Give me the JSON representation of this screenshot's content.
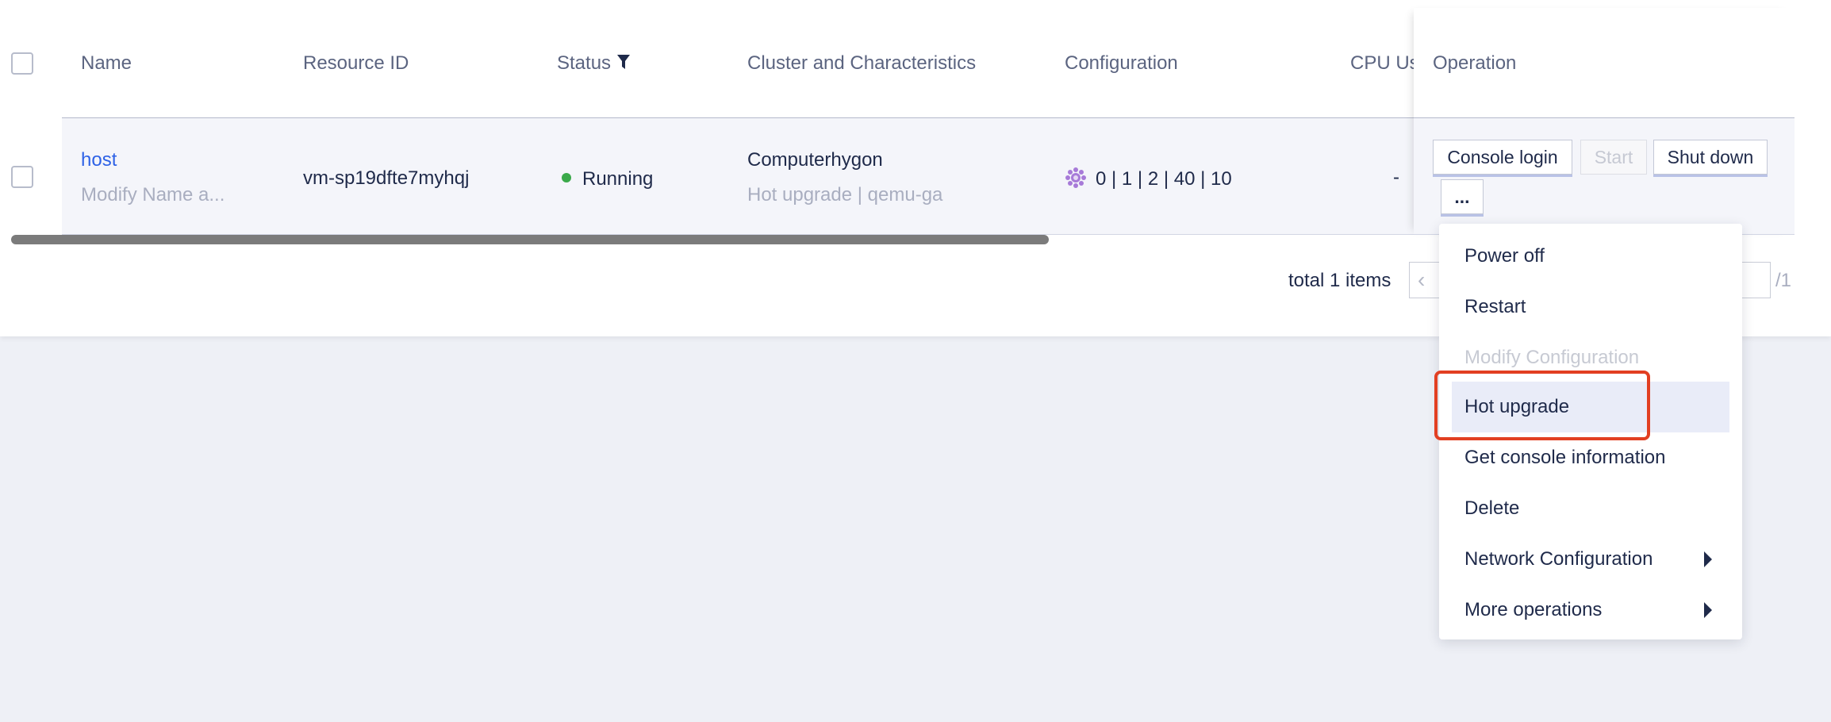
{
  "table": {
    "headers": {
      "name": "Name",
      "resource_id": "Resource ID",
      "status": "Status",
      "cluster": "Cluster and Characteristics",
      "configuration": "Configuration",
      "cpu": "CPU Us",
      "operation": "Operation"
    },
    "row": {
      "name": "host",
      "name_sub": "Modify Name a...",
      "resource_id": "vm-sp19dfte7myhqj",
      "status": "Running",
      "cluster": "Computerhygon",
      "cluster_sub": "Hot upgrade | qemu-ga",
      "configuration": "0 | 1 | 2 | 40 | 10",
      "cpu": "-"
    },
    "status_color": "#3aa94a"
  },
  "operations": {
    "console_login": "Console login",
    "start": "Start",
    "shut_down": "Shut down",
    "more": "..."
  },
  "pagination": {
    "total": "total 1 items",
    "prev_icon": "‹",
    "page_total": "/1"
  },
  "menu": {
    "items": [
      {
        "label": "Power off"
      },
      {
        "label": "Restart"
      },
      {
        "label": "Modify Configuration"
      },
      {
        "label": "Hot upgrade"
      },
      {
        "label": "Get console information"
      },
      {
        "label": "Delete"
      },
      {
        "label": "Network Configuration"
      },
      {
        "label": "More operations"
      }
    ]
  },
  "colors": {
    "link": "#2e62e6",
    "highlight_border": "#e23f22"
  }
}
